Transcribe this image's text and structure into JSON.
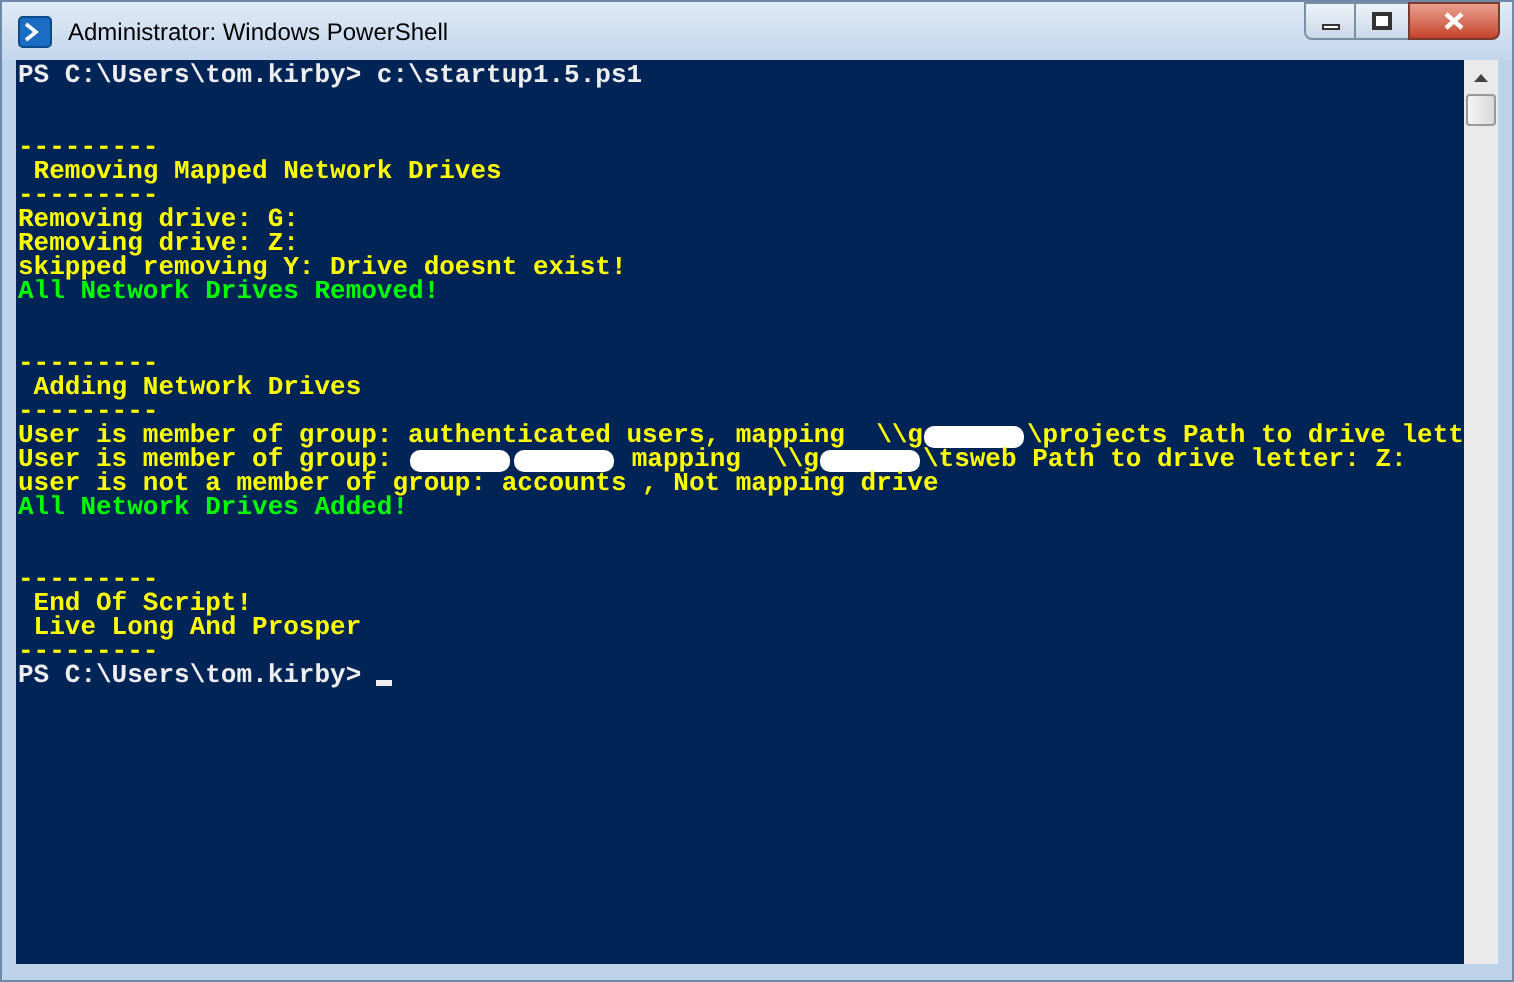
{
  "window": {
    "title": "Administrator: Windows PowerShell"
  },
  "console": {
    "lines": [
      {
        "kind": "text",
        "color": "#eeeeee",
        "cursor": false,
        "segments": [
          {
            "kind": "text",
            "text": "PS C:\\Users\\tom.kirby> c:\\startup1.5.ps1"
          }
        ]
      },
      {
        "kind": "blank"
      },
      {
        "kind": "blank"
      },
      {
        "kind": "text",
        "color": "#ffff00",
        "cursor": false,
        "segments": [
          {
            "kind": "text",
            "text": "---------"
          }
        ]
      },
      {
        "kind": "text",
        "color": "#ffff00",
        "cursor": false,
        "segments": [
          {
            "kind": "text",
            "text": " Removing Mapped Network Drives"
          }
        ]
      },
      {
        "kind": "text",
        "color": "#ffff00",
        "cursor": false,
        "segments": [
          {
            "kind": "text",
            "text": "---------"
          }
        ]
      },
      {
        "kind": "text",
        "color": "#ffff00",
        "cursor": false,
        "segments": [
          {
            "kind": "text",
            "text": "Removing drive: G:"
          }
        ]
      },
      {
        "kind": "text",
        "color": "#ffff00",
        "cursor": false,
        "segments": [
          {
            "kind": "text",
            "text": "Removing drive: Z:"
          }
        ]
      },
      {
        "kind": "text",
        "color": "#ffff00",
        "cursor": false,
        "segments": [
          {
            "kind": "text",
            "text": "skipped removing Y: Drive doesnt exist!"
          }
        ]
      },
      {
        "kind": "text",
        "color": "#00ff00",
        "cursor": false,
        "segments": [
          {
            "kind": "text",
            "text": "All Network Drives Removed!"
          }
        ]
      },
      {
        "kind": "blank"
      },
      {
        "kind": "blank"
      },
      {
        "kind": "text",
        "color": "#ffff00",
        "cursor": false,
        "segments": [
          {
            "kind": "text",
            "text": "---------"
          }
        ]
      },
      {
        "kind": "text",
        "color": "#ffff00",
        "cursor": false,
        "segments": [
          {
            "kind": "text",
            "text": " Adding Network Drives"
          }
        ]
      },
      {
        "kind": "text",
        "color": "#ffff00",
        "cursor": false,
        "segments": [
          {
            "kind": "text",
            "text": "---------"
          }
        ]
      },
      {
        "kind": "text",
        "color": "#ffff00",
        "cursor": false,
        "segments": [
          {
            "kind": "text",
            "text": "User is member of group: authenticated users, mapping  \\\\g"
          },
          {
            "kind": "redaction"
          },
          {
            "kind": "text",
            "text": "\\projects Path to drive lett"
          }
        ]
      },
      {
        "kind": "text",
        "color": "#ffff00",
        "cursor": false,
        "segments": [
          {
            "kind": "text",
            "text": "User is member of group: "
          },
          {
            "kind": "redaction"
          },
          {
            "kind": "redaction"
          },
          {
            "kind": "text",
            "text": " mapping  \\\\g"
          },
          {
            "kind": "redaction"
          },
          {
            "kind": "text",
            "text": "\\tsweb Path to drive letter: Z:"
          }
        ]
      },
      {
        "kind": "text",
        "color": "#ffff00",
        "cursor": false,
        "segments": [
          {
            "kind": "text",
            "text": "user is not a member of group: accounts , Not mapping drive"
          }
        ]
      },
      {
        "kind": "text",
        "color": "#00ff00",
        "cursor": false,
        "segments": [
          {
            "kind": "text",
            "text": "All Network Drives Added!"
          }
        ]
      },
      {
        "kind": "blank"
      },
      {
        "kind": "blank"
      },
      {
        "kind": "text",
        "color": "#ffff00",
        "cursor": false,
        "segments": [
          {
            "kind": "text",
            "text": "---------"
          }
        ]
      },
      {
        "kind": "text",
        "color": "#ffff00",
        "cursor": false,
        "segments": [
          {
            "kind": "text",
            "text": " End Of Script!"
          }
        ]
      },
      {
        "kind": "text",
        "color": "#ffff00",
        "cursor": false,
        "segments": [
          {
            "kind": "text",
            "text": " Live Long And Prosper"
          }
        ]
      },
      {
        "kind": "text",
        "color": "#ffff00",
        "cursor": false,
        "segments": [
          {
            "kind": "text",
            "text": "---------"
          }
        ]
      },
      {
        "kind": "text",
        "color": "#eeeeee",
        "cursor": true,
        "segments": [
          {
            "kind": "text",
            "text": "PS C:\\Users\\tom.kirby> "
          }
        ]
      }
    ]
  }
}
